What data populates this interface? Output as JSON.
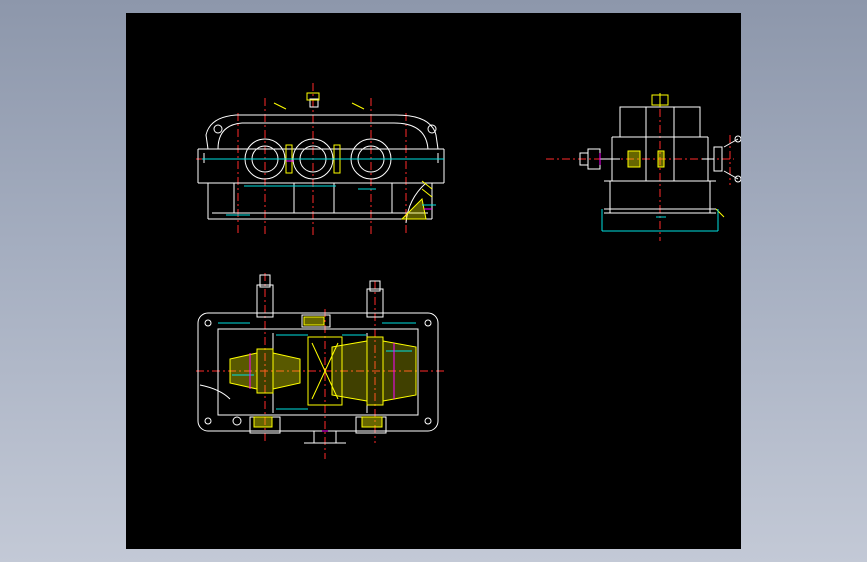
{
  "viewer": {
    "background_gradient": [
      "#8d97ab",
      "#c3c9d6"
    ],
    "canvas_color": "#000000"
  },
  "drawing": {
    "colors": {
      "outline": "#ffffff",
      "centerline": "#ff2a2a",
      "dimension": "#00e0e0",
      "hatch": "#ffff00",
      "accent": "#ff00ff"
    },
    "views": [
      "front-view",
      "side-view",
      "top-section-view"
    ]
  }
}
